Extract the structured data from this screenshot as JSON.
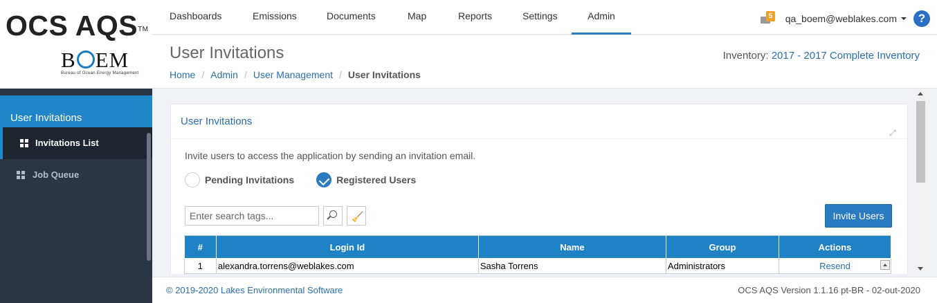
{
  "logo": {
    "main": "OCS AQS",
    "tm": "TM",
    "boem_b": "B",
    "boem_rest": "EM",
    "sub": "Bureau of Ocean Energy Management"
  },
  "nav": {
    "items": [
      "Dashboards",
      "Emissions",
      "Documents",
      "Map",
      "Reports",
      "Settings",
      "Admin"
    ],
    "active": "Admin",
    "notifications": "5",
    "user": "qa_boem@weblakes.com",
    "help": "?"
  },
  "header": {
    "title": "User Invitations",
    "breadcrumb": [
      "Home",
      "Admin",
      "User Management",
      "User Invitations"
    ],
    "inventory_label": "Inventory:",
    "inventory_value": "2017 - 2017 Complete Inventory"
  },
  "sidebar": {
    "title": "User Invitations",
    "items": [
      {
        "label": "Invitations List",
        "active": true
      },
      {
        "label": "Job Queue",
        "active": false
      }
    ]
  },
  "portlet": {
    "title": "User Invitations",
    "intro": "Invite users to access the application by sending an invitation email.",
    "radios": [
      {
        "label": "Pending Invitations",
        "checked": false
      },
      {
        "label": "Registered Users",
        "checked": true
      }
    ],
    "search_placeholder": "Enter search tags...",
    "invite_button": "Invite Users"
  },
  "table": {
    "columns": [
      "#",
      "Login Id",
      "Name",
      "Group",
      "Actions"
    ],
    "rows": [
      {
        "num": "1",
        "login": "alexandra.torrens@weblakes.com",
        "name": "Sasha Torrens",
        "group": "Administrators",
        "action": "Resend"
      }
    ]
  },
  "footer": {
    "copyright": "© 2019-2020 Lakes Environmental Software",
    "version": "OCS AQS Version 1.1.16 pt-BR - 02-out-2020"
  },
  "colors": {
    "primary": "#1f82c4",
    "sidebar": "#2b3643",
    "badge": "#f0a12a"
  }
}
